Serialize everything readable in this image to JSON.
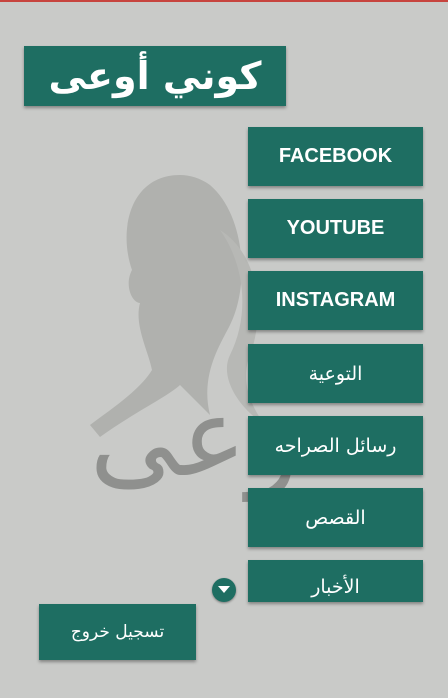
{
  "header": {
    "title": "كوني أوعى"
  },
  "menu": [
    {
      "label": "FACEBOOK"
    },
    {
      "label": "YOUTUBE"
    },
    {
      "label": "INSTAGRAM"
    },
    {
      "label": "التوعية"
    },
    {
      "label": "رسائل الصراحه"
    },
    {
      "label": "القصص"
    },
    {
      "label": "الأخبار"
    }
  ],
  "footer": {
    "logout_label": "تسجيل خروج"
  },
  "watermark": {
    "text": "أوعى",
    "icon": "woman-silhouette-logo"
  },
  "colors": {
    "accent": "#1e6e62",
    "background": "#c9cac8",
    "text": "#ffffff"
  }
}
